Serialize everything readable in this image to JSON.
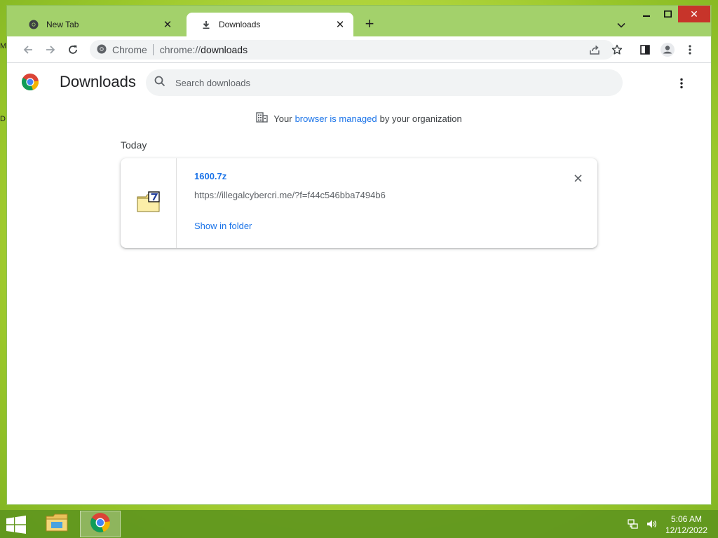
{
  "tabs": [
    {
      "title": "New Tab",
      "icon": "chrome-icon"
    },
    {
      "title": "Downloads",
      "icon": "download-icon"
    }
  ],
  "omnibox": {
    "site_label": "Chrome",
    "url_scheme": "chrome://",
    "url_host": "downloads"
  },
  "page": {
    "title": "Downloads",
    "search_placeholder": "Search downloads",
    "managed_notice": {
      "prefix": "Your",
      "link": "browser is managed",
      "suffix": "by your organization"
    },
    "section": "Today",
    "download": {
      "filename": "1600.7z",
      "url": "https://illegalcybercri.me/?f=f44c546bba7494b6",
      "action": "Show in folder"
    }
  },
  "taskbar": {
    "time": "5:06 AM",
    "date": "12/12/2022"
  },
  "colors": {
    "accent": "#1a73e8",
    "frame": "#a3d16b",
    "close_button": "#c7342a"
  }
}
